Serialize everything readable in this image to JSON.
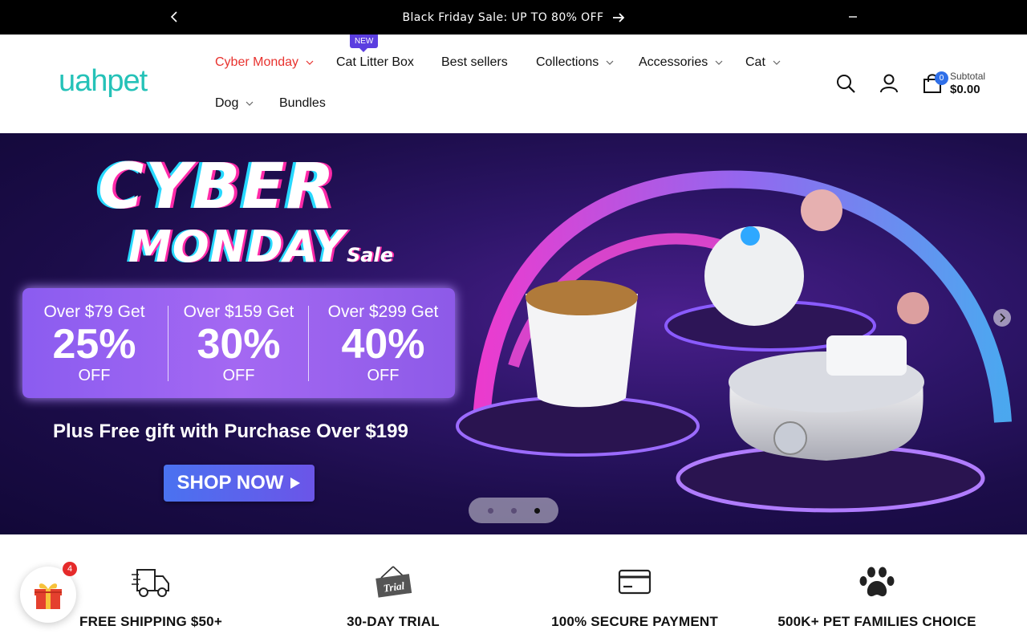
{
  "announcement": {
    "text": "Black Friday Sale: UP TO 80% OFF"
  },
  "header": {
    "logo_text": "uahpet",
    "nav": [
      {
        "label": "Cyber Monday",
        "has_dropdown": true,
        "active": true
      },
      {
        "label": "Cat Litter Box",
        "has_dropdown": false,
        "badge": "NEW"
      },
      {
        "label": "Best sellers",
        "has_dropdown": false
      },
      {
        "label": "Collections",
        "has_dropdown": true
      },
      {
        "label": "Accessories",
        "has_dropdown": true
      },
      {
        "label": "Cat",
        "has_dropdown": true
      },
      {
        "label": "Dog",
        "has_dropdown": true
      },
      {
        "label": "Bundles",
        "has_dropdown": false
      }
    ],
    "cart": {
      "count": "0",
      "subtotal_label": "Subtotal",
      "subtotal_value": "$0.00"
    }
  },
  "hero": {
    "title_line1": "CYBER",
    "title_line2": "MONDAY",
    "title_sale": "Sale",
    "deals": [
      {
        "over": "Over $79 Get",
        "percent": "25%",
        "off": "OFF"
      },
      {
        "over": "Over $159 Get",
        "percent": "30%",
        "off": "OFF"
      },
      {
        "over": "Over $299 Get",
        "percent": "40%",
        "off": "OFF"
      }
    ],
    "gift_text": "Plus Free gift with Purchase Over $199",
    "cta": "SHOP NOW",
    "slides_total": 3,
    "slide_active": 3
  },
  "features": [
    {
      "icon": "truck-icon",
      "label": "FREE SHIPPING $50+"
    },
    {
      "icon": "trial-sign-icon",
      "label": "30-DAY TRIAL"
    },
    {
      "icon": "credit-card-icon",
      "label": "100% SECURE PAYMENT"
    },
    {
      "icon": "paw-icon",
      "label": "500K+ PET FAMILIES CHOICE"
    }
  ],
  "gift_widget": {
    "count": "4"
  },
  "colors": {
    "brand_teal": "#25c2b8",
    "accent_red": "#e8322e",
    "badge_purple": "#5b3ee0",
    "cart_blue": "#2f6fe8"
  }
}
